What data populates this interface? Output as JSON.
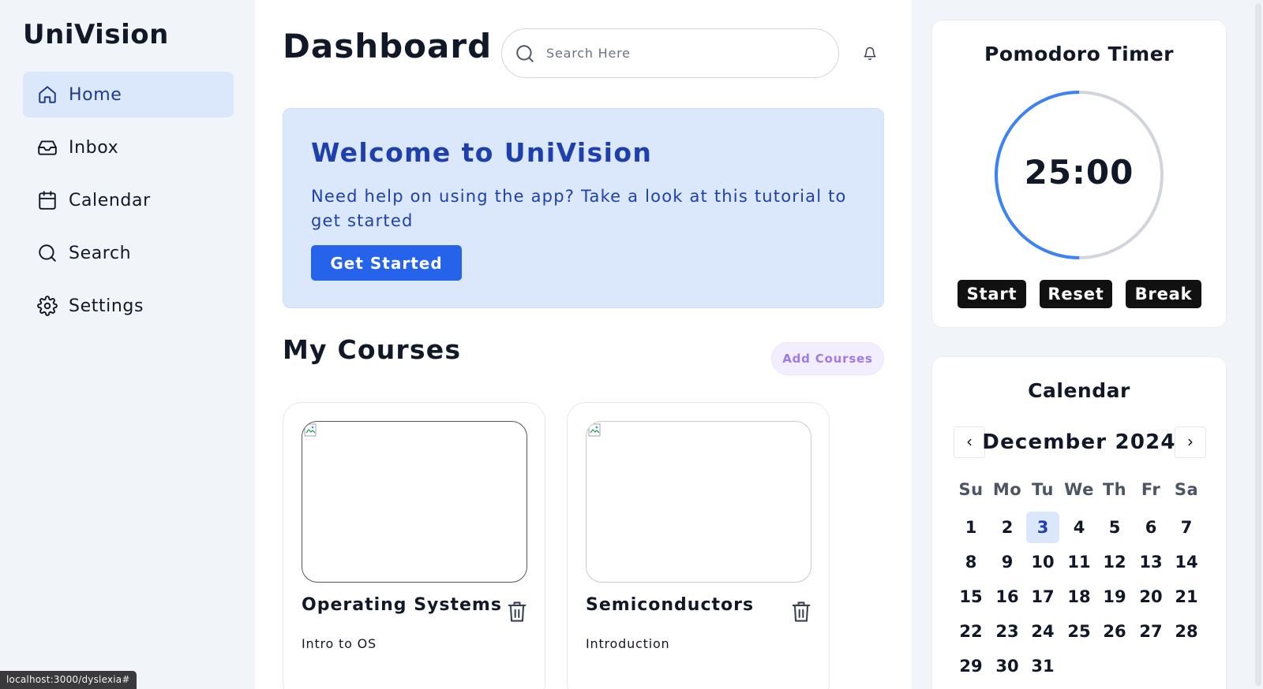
{
  "sidebar": {
    "brand": "UniVision",
    "items": [
      {
        "label": "Home",
        "icon": "home-icon"
      },
      {
        "label": "Inbox",
        "icon": "inbox-icon"
      },
      {
        "label": "Calendar",
        "icon": "calendar-icon"
      },
      {
        "label": "Search",
        "icon": "search-icon"
      },
      {
        "label": "Settings",
        "icon": "gear-icon"
      }
    ],
    "active_item": "Home"
  },
  "header": {
    "title": "Dashboard",
    "search_placeholder": "Search Here"
  },
  "welcome": {
    "title": "Welcome to UniVision",
    "text": "Need help on using the app? Take a look at this tutorial to get started",
    "button": "Get Started"
  },
  "courses": {
    "title": "My Courses",
    "add_button": "Add Courses",
    "items": [
      {
        "name": "Operating Systems",
        "subtitle": "Intro to OS"
      },
      {
        "name": "Semiconductors",
        "subtitle": "Introduction"
      }
    ]
  },
  "pomodoro": {
    "title": "Pomodoro Timer",
    "time": "25:00",
    "progress_fraction": 0.5,
    "buttons": {
      "start": "Start",
      "reset": "Reset",
      "break": "Break"
    }
  },
  "calendar": {
    "title": "Calendar",
    "month_label": "December 2024",
    "weekdays": [
      "Su",
      "Mo",
      "Tu",
      "We",
      "Th",
      "Fr",
      "Sa"
    ],
    "days": [
      "1",
      "2",
      "3",
      "4",
      "5",
      "6",
      "7",
      "8",
      "9",
      "10",
      "11",
      "12",
      "13",
      "14",
      "15",
      "16",
      "17",
      "18",
      "19",
      "20",
      "21",
      "22",
      "23",
      "24",
      "25",
      "26",
      "27",
      "28",
      "29",
      "30",
      "31"
    ],
    "today": "3"
  },
  "status_bar": {
    "url": "localhost:3000/dyslexia#"
  },
  "colors": {
    "accent": "#2563eb",
    "accent_dark": "#1e40af",
    "highlight_bg": "#dbe8fc",
    "add_button_bg": "#f3eefe",
    "add_button_text": "#9f7aea"
  }
}
